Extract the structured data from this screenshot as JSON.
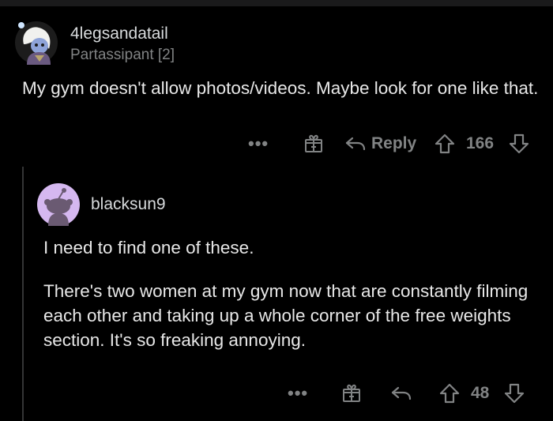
{
  "comment": {
    "username": "4legsandatail",
    "flair": "Partassipant [2]",
    "body": "My gym doesn't allow photos/videos. Maybe look for one like that.",
    "actions": {
      "more_label": "•••",
      "reply_label": "Reply",
      "votes": "166"
    }
  },
  "reply": {
    "username": "blacksun9",
    "paragraphs": [
      "I need to find one of these.",
      "There's two women at my gym now that are constantly filming each other and taking up a whole corner of the free weights section. It's so freaking annoying."
    ],
    "actions": {
      "more_label": "•••",
      "votes": "48"
    }
  },
  "colors": {
    "background": "#000000",
    "text": "#e8e8e8",
    "muted": "#818384",
    "thread_line": "#343536",
    "avatar_bg": "#d5b8f0"
  },
  "icons": [
    "user-avatar-icon",
    "award-gift-icon",
    "reply-arrow-icon",
    "upvote-arrow-icon",
    "downvote-arrow-icon",
    "more-dots-icon"
  ]
}
